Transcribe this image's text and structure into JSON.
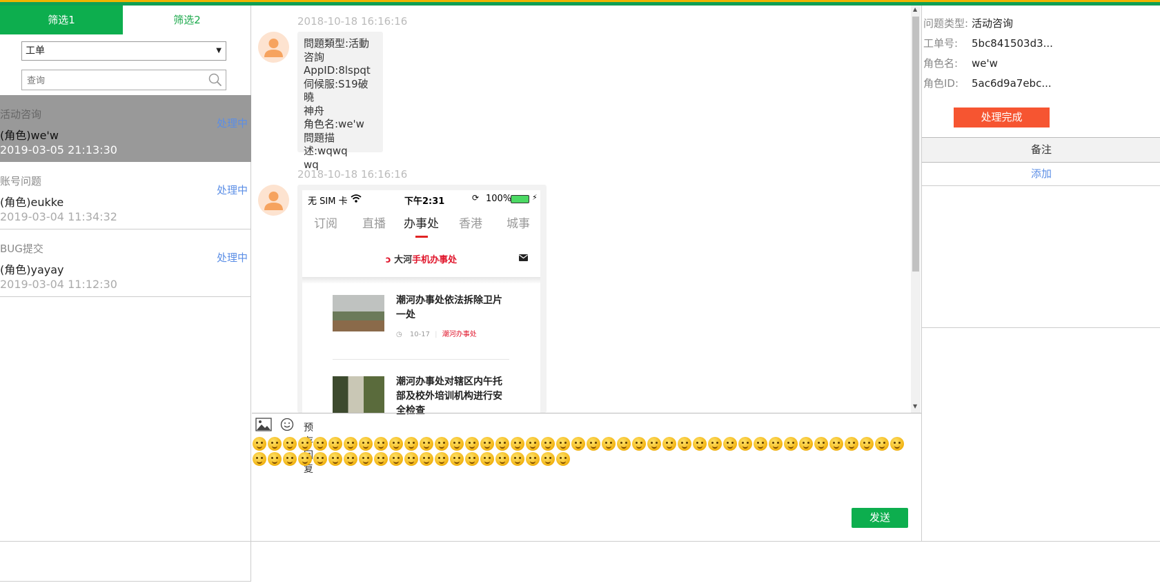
{
  "left": {
    "tabs": [
      "筛选1",
      "筛选2"
    ],
    "select_value": "工单",
    "search_placeholder": "查询",
    "tickets": [
      {
        "title": "活动咨询",
        "role": "(角色)we'w",
        "date": "2019-03-05 21:13:30",
        "status": "处理中"
      },
      {
        "title": "账号问题",
        "role": "(角色)eukke",
        "date": "2019-03-04 11:34:32",
        "status": "处理中"
      },
      {
        "title": "BUG提交",
        "role": "(角色)yayay",
        "date": "2019-03-04 11:12:30",
        "status": "处理中"
      }
    ]
  },
  "chat": {
    "messages": [
      {
        "time": "2018-10-18 16:16:16",
        "text": "問題類型:活動\n咨詢\nAppID:8lspqt\n伺候服:S19破曉\n神舟\n角色名:we'w\n問題描述:wqwq\nwq"
      },
      {
        "time": "2018-10-18 16:16:16"
      }
    ],
    "phone": {
      "carrier": "无 SIM 卡",
      "clock": "下午2:31",
      "battery": "100%",
      "tabs": [
        "订阅",
        "直播",
        "办事处",
        "香港",
        "城事"
      ],
      "brand_black": "大河",
      "brand_red": "手机办事处",
      "news": [
        {
          "title": "潮河办事处依法拆除卫片一处",
          "date": "10-17",
          "source": "潮河办事处"
        },
        {
          "title": "潮河办事处对辖区内午托部及校外培训机构进行安全检查",
          "date": "",
          "source": ""
        }
      ]
    }
  },
  "input": {
    "preset_label": "预存回复",
    "send_label": "发送",
    "emoji_count": 64
  },
  "right": {
    "fields": [
      {
        "key": "问题类型:",
        "value": "活动咨询"
      },
      {
        "key": "工单号:",
        "value": "5bc841503d3..."
      },
      {
        "key": "角色名:",
        "value": "we'w"
      },
      {
        "key": "角色ID:",
        "value": "5ac6d9a7ebc..."
      }
    ],
    "done_label": "处理完成",
    "note_header": "备注",
    "note_add": "添加"
  },
  "colors": {
    "accent_green": "#0dae4e",
    "done_orange": "#f65531",
    "status_blue": "#5b8ee6"
  }
}
